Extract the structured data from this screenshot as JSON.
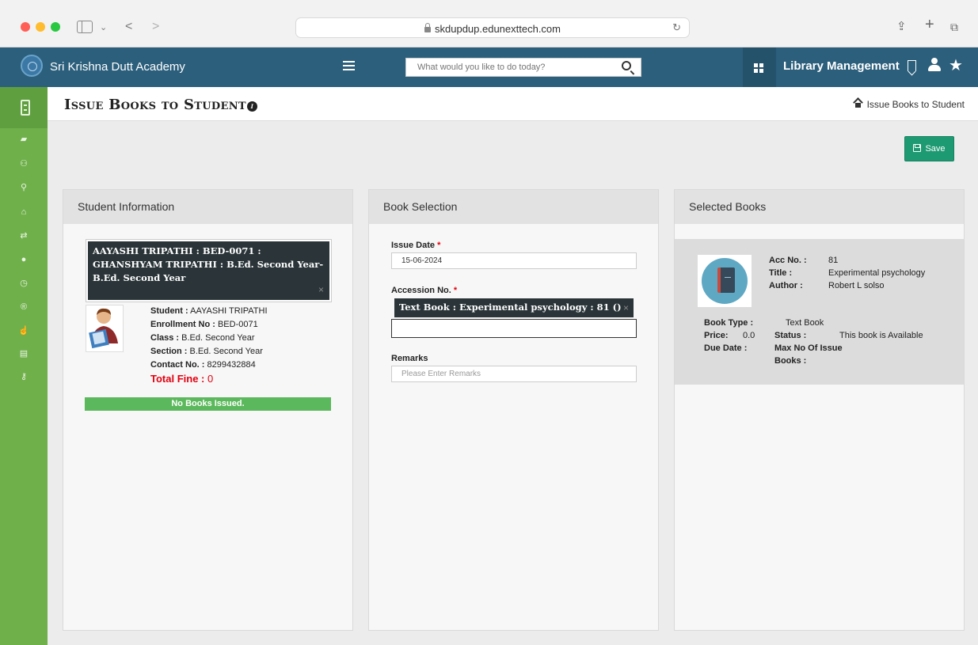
{
  "browser": {
    "url": "skdupdup.edunexttech.com"
  },
  "header": {
    "school_name": "Sri Krishna Dutt Academy",
    "search_placeholder": "What would you like to do today?",
    "module_title": "Library Management"
  },
  "page": {
    "title": "Issue Books to Student",
    "breadcrumb": "Issue Books to Student",
    "save_label": "Save"
  },
  "student_panel": {
    "heading": "Student Information",
    "selected_tag": "AAYASHI TRIPATHI : BED-0071 : GHANSHYAM TRIPATHI : B.Ed. Second Year-B.Ed. Second Year",
    "tag_remove": "×",
    "fields": {
      "student_label": "Student :",
      "student_value": "AAYASHI TRIPATHI",
      "enrollment_label": "Enrollment No :",
      "enrollment_value": "BED-0071",
      "class_label": "Class :",
      "class_value": "B.Ed. Second Year",
      "section_label": "Section :",
      "section_value": "B.Ed. Second Year",
      "contact_label": "Contact No. :",
      "contact_value": "8299432884",
      "fine_label": "Total Fine :",
      "fine_value": "0"
    },
    "issued_status": "No Books Issued."
  },
  "book_panel": {
    "heading": "Book Selection",
    "issue_date_label": "Issue Date",
    "issue_date_value": "15-06-2024",
    "accession_label": "Accession No.",
    "accession_tag": "Text Book : Experimental psychology : 81 ()",
    "tag_remove": "×",
    "remarks_label": "Remarks",
    "remarks_placeholder": "Please Enter Remarks",
    "required_mark": "*"
  },
  "selected_panel": {
    "heading": "Selected Books",
    "book": {
      "acc_label": "Acc No. :",
      "acc_value": "81",
      "title_label": "Title :",
      "title_value": "Experimental psychology",
      "author_label": "Author :",
      "author_value": "Robert L solso",
      "type_label": "Book Type :",
      "type_value": "Text Book",
      "price_label": "Price:",
      "price_value": "0.0",
      "status_label": "Status :",
      "status_value": "This book is Available",
      "due_label": "Due Date :",
      "max_label_1": "Max No Of Issue",
      "max_label_2": "Books :"
    }
  },
  "colors": {
    "header_bg": "#2c5f7c",
    "sidebar_bg": "#6fb04b",
    "save_button": "#1e9a72",
    "status_green": "#5cb85c",
    "tag_dark": "#2b3539",
    "fine_red": "#e3000f"
  },
  "icons": [
    "sidebar-toggle-icon",
    "chevron-down-icon",
    "back-icon",
    "forward-icon",
    "lock-icon",
    "reload-icon",
    "share-icon",
    "new-tab-icon",
    "tabs-icon",
    "menu-icon",
    "search-icon",
    "apps-icon",
    "bookmark-icon",
    "user-icon",
    "star-icon",
    "home-icon",
    "save-icon",
    "info-icon"
  ]
}
